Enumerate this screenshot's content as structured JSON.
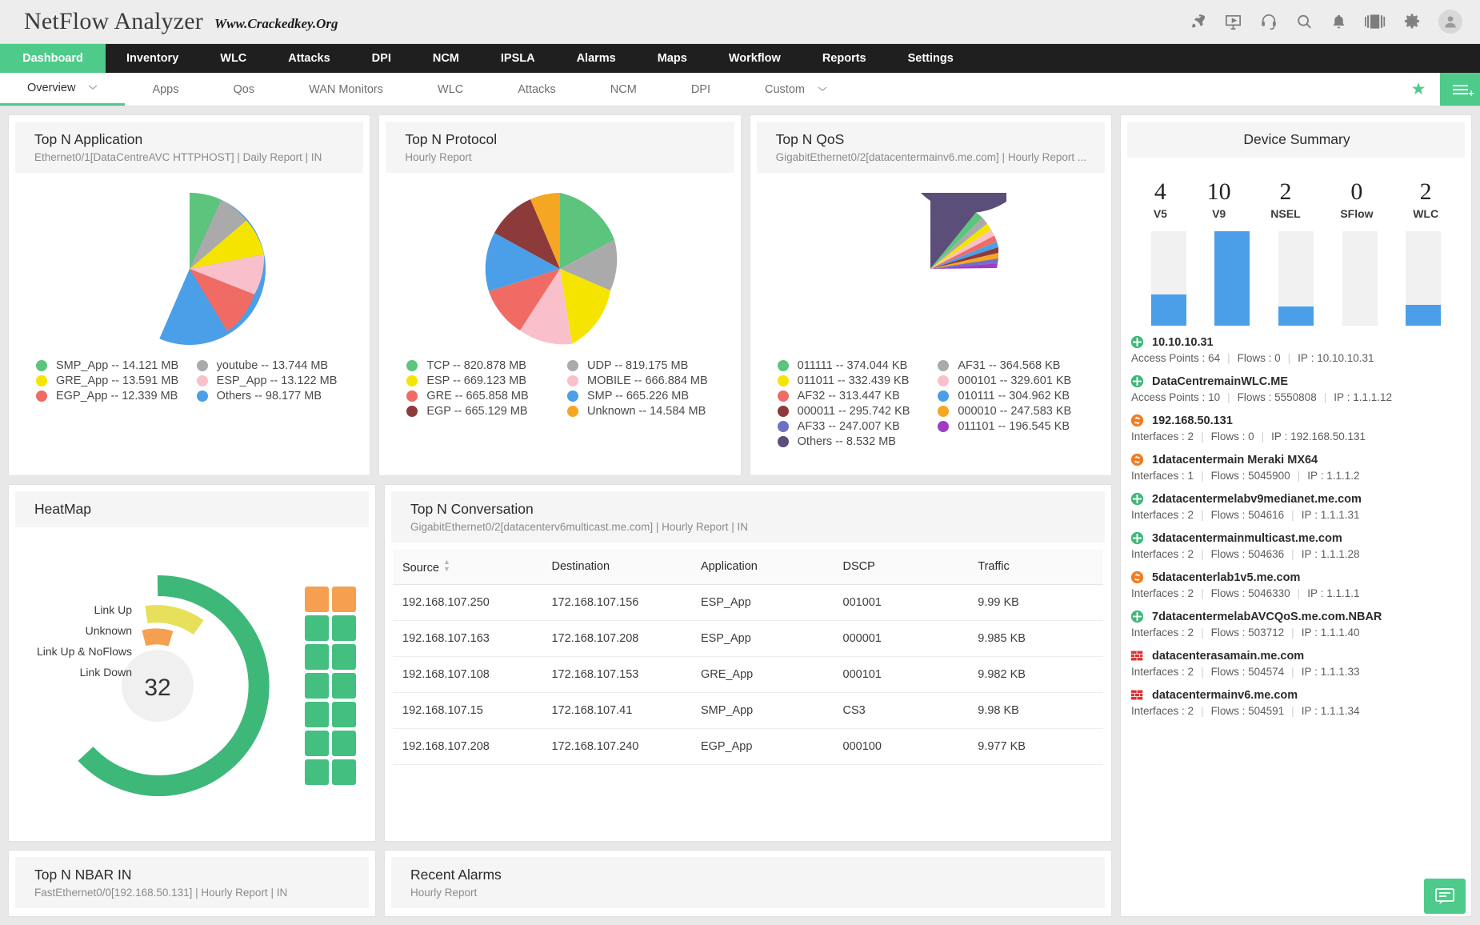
{
  "header": {
    "brand": "NetFlow Analyzer",
    "watermark": "Www.Crackedkey.Org",
    "icons": [
      {
        "name": "rocket-icon",
        "label": "rocket"
      },
      {
        "name": "presentation-icon",
        "label": "presentation"
      },
      {
        "name": "headset-icon",
        "label": "support"
      },
      {
        "name": "search-icon",
        "label": "search"
      },
      {
        "name": "bell-icon",
        "label": "notifications"
      },
      {
        "name": "layout-icon",
        "label": "layout"
      },
      {
        "name": "gear-icon",
        "label": "settings"
      },
      {
        "name": "avatar-icon",
        "label": "user"
      }
    ]
  },
  "mainnav": [
    {
      "label": "Dashboard",
      "active": true
    },
    {
      "label": "Inventory",
      "active": false
    },
    {
      "label": "WLC",
      "active": false
    },
    {
      "label": "Attacks",
      "active": false
    },
    {
      "label": "DPI",
      "active": false
    },
    {
      "label": "NCM",
      "active": false
    },
    {
      "label": "IPSLA",
      "active": false
    },
    {
      "label": "Alarms",
      "active": false
    },
    {
      "label": "Maps",
      "active": false
    },
    {
      "label": "Workflow",
      "active": false
    },
    {
      "label": "Reports",
      "active": false
    },
    {
      "label": "Settings",
      "active": false
    }
  ],
  "subnav": [
    {
      "label": "Overview",
      "active": true,
      "caret": "⌄"
    },
    {
      "label": "Apps",
      "active": false,
      "caret": ""
    },
    {
      "label": "Qos",
      "active": false,
      "caret": ""
    },
    {
      "label": "WAN Monitors",
      "active": false,
      "caret": ""
    },
    {
      "label": "WLC",
      "active": false,
      "caret": ""
    },
    {
      "label": "Attacks",
      "active": false,
      "caret": ""
    },
    {
      "label": "NCM",
      "active": false,
      "caret": ""
    },
    {
      "label": "DPI",
      "active": false,
      "caret": ""
    },
    {
      "label": "Custom",
      "active": false,
      "caret": "⌄"
    }
  ],
  "subnav_actions": {
    "star": "★",
    "burger_plus": "+"
  },
  "chart_data": [
    {
      "type": "pie",
      "title": "Top N Application",
      "subtitle": "Ethernet0/1[DataCentreAVC HTTPHOST] | Daily Report | IN",
      "unit": "MB",
      "legend_position": "bottom",
      "labels": [
        "SMP_App",
        "GRE_App",
        "EGP_App",
        "youtube",
        "ESP_App",
        "Others"
      ],
      "values": [
        14.121,
        13.591,
        12.339,
        13.744,
        13.122,
        98.177
      ],
      "colors": [
        "#5cc47c",
        "#f5e400",
        "#f06b64",
        "#aaaaaa",
        "#f9c0cb",
        "#4a9fe8"
      ],
      "legend": [
        {
          "label": "SMP_App -- 14.121 MB",
          "color": "#5cc47c"
        },
        {
          "label": "GRE_App -- 13.591 MB",
          "color": "#f5e400"
        },
        {
          "label": "EGP_App -- 12.339 MB",
          "color": "#f06b64"
        },
        {
          "label": "youtube -- 13.744 MB",
          "color": "#aaaaaa"
        },
        {
          "label": "ESP_App -- 13.122 MB",
          "color": "#f9c0cb"
        },
        {
          "label": "Others -- 98.177 MB",
          "color": "#4a9fe8"
        }
      ]
    },
    {
      "type": "pie",
      "title": "Top N Protocol",
      "subtitle": "Hourly Report",
      "unit": "MB",
      "legend_position": "bottom",
      "labels": [
        "TCP",
        "ESP",
        "GRE",
        "EGP",
        "UDP",
        "MOBILE",
        "SMP",
        "Unknown"
      ],
      "values": [
        820.878,
        669.123,
        665.858,
        665.129,
        819.175,
        666.884,
        665.226,
        14.584
      ],
      "colors": [
        "#5cc47c",
        "#f5e400",
        "#f06b64",
        "#8c3a3a",
        "#aaaaaa",
        "#f9c0cb",
        "#4a9fe8",
        "#f5a623"
      ],
      "legend": [
        {
          "label": "TCP -- 820.878 MB",
          "color": "#5cc47c"
        },
        {
          "label": "ESP -- 669.123 MB",
          "color": "#f5e400"
        },
        {
          "label": "GRE -- 665.858 MB",
          "color": "#f06b64"
        },
        {
          "label": "EGP -- 665.129 MB",
          "color": "#8c3a3a"
        },
        {
          "label": "UDP -- 819.175 MB",
          "color": "#aaaaaa"
        },
        {
          "label": "MOBILE -- 666.884 MB",
          "color": "#f9c0cb"
        },
        {
          "label": "SMP -- 665.226 MB",
          "color": "#4a9fe8"
        },
        {
          "label": "Unknown -- 14.584 MB",
          "color": "#f5a623"
        }
      ]
    },
    {
      "type": "pie",
      "title": "Top N QoS",
      "subtitle": "GigabitEthernet0/2[datacentermainv6.me.com] | Hourly Report ...",
      "unit": "KB",
      "legend_position": "bottom",
      "labels": [
        "011111",
        "011011",
        "AF32",
        "000011",
        "AF33",
        "Others",
        "AF31",
        "000101",
        "010111",
        "000010",
        "011101"
      ],
      "values": [
        374.044,
        332.439,
        313.447,
        295.742,
        247.007,
        8532,
        364.568,
        329.601,
        304.962,
        247.583,
        196.545
      ],
      "colors": [
        "#5cc47c",
        "#f5e400",
        "#f06b64",
        "#8c3a3a",
        "#6f6fc4",
        "#5b4e78",
        "#aaaaaa",
        "#f9c0cb",
        "#4a9fe8",
        "#f5a623",
        "#a03cc4"
      ],
      "legend": [
        {
          "label": "011111 -- 374.044 KB",
          "color": "#5cc47c"
        },
        {
          "label": "011011 -- 332.439 KB",
          "color": "#f5e400"
        },
        {
          "label": "AF32 -- 313.447 KB",
          "color": "#f06b64"
        },
        {
          "label": "000011 -- 295.742 KB",
          "color": "#8c3a3a"
        },
        {
          "label": "AF33 -- 247.007 KB",
          "color": "#6f6fc4"
        },
        {
          "label": "Others -- 8.532 MB",
          "color": "#5b4e78"
        },
        {
          "label": "AF31 -- 364.568 KB",
          "color": "#aaaaaa"
        },
        {
          "label": "000101 -- 329.601 KB",
          "color": "#f9c0cb"
        },
        {
          "label": "010111 -- 304.962 KB",
          "color": "#4a9fe8"
        },
        {
          "label": "000010 -- 247.583 KB",
          "color": "#f5a623"
        },
        {
          "label": "011101 -- 196.545 KB",
          "color": "#a03cc4"
        }
      ]
    },
    {
      "type": "pie",
      "title": "HeatMap",
      "subtitle": "",
      "center_value": "32",
      "labels": [
        "Link Up",
        "Unknown",
        "Link Up & NoFlows",
        "Link Down"
      ],
      "values": [
        28,
        3,
        1,
        0
      ],
      "colors": [
        "#3eb878",
        "#e6e05a",
        "#f5a050",
        "#cccccc"
      ],
      "legend": [
        {
          "label": "Link Up",
          "color": "#3eb878"
        },
        {
          "label": "Unknown",
          "color": "#e6e05a"
        },
        {
          "label": "Link Up & NoFlows",
          "color": "#f5a050"
        },
        {
          "label": "Link Down",
          "color": "#cccccc"
        }
      ],
      "grid_cells": [
        "#f5a050",
        "#f5a050",
        "#43bf80",
        "#43bf80",
        "#43bf80",
        "#43bf80",
        "#43bf80",
        "#43bf80",
        "#43bf80",
        "#43bf80",
        "#43bf80",
        "#43bf80",
        "#43bf80",
        "#43bf80"
      ]
    },
    {
      "type": "bar",
      "title": "Device Summary",
      "categories": [
        "V5",
        "V9",
        "NSEL",
        "SFlow",
        "WLC"
      ],
      "values": [
        4,
        10,
        2,
        0,
        2
      ],
      "fill_pct": [
        33,
        100,
        20,
        0,
        22
      ],
      "color": "#4a9fe8",
      "track_color": "#f1f1f1"
    }
  ],
  "cards": {
    "top_application": {
      "title": "Top N Application",
      "subtitle": "Ethernet0/1[DataCentreAVC HTTPHOST] | Daily Report | IN"
    },
    "top_protocol": {
      "title": "Top N Protocol",
      "subtitle": "Hourly Report"
    },
    "top_qos": {
      "title": "Top N QoS",
      "subtitle": "GigabitEthernet0/2[datacentermainv6.me.com] | Hourly Report ..."
    },
    "device_summary": {
      "title": "Device Summary"
    },
    "heatmap": {
      "title": "HeatMap"
    },
    "top_conversation": {
      "title": "Top N Conversation",
      "subtitle": "GigabitEthernet0/2[datacenterv6multicast.me.com] | Hourly Report | IN"
    },
    "recent_alarms": {
      "title": "Recent Alarms",
      "subtitle": "Hourly Report"
    },
    "top_nbar": {
      "title": "Top N NBAR IN",
      "subtitle": "FastEthernet0/0[192.168.50.131] | Hourly Report | IN"
    }
  },
  "conversation_table": {
    "columns": [
      "Source",
      "Destination",
      "Application",
      "DSCP",
      "Traffic"
    ],
    "sorted_column": "Source",
    "rows": [
      {
        "source": "192.168.107.250",
        "destination": "172.168.107.156",
        "application": "ESP_App",
        "dscp": "001001",
        "traffic": "9.99 KB"
      },
      {
        "source": "192.168.107.163",
        "destination": "172.168.107.208",
        "application": "ESP_App",
        "dscp": "000001",
        "traffic": "9.985 KB"
      },
      {
        "source": "192.168.107.108",
        "destination": "172.168.107.153",
        "application": "GRE_App",
        "dscp": "000101",
        "traffic": "9.982 KB"
      },
      {
        "source": "192.168.107.15",
        "destination": "172.168.107.41",
        "application": "SMP_App",
        "dscp": "CS3",
        "traffic": "9.98 KB"
      },
      {
        "source": "192.168.107.208",
        "destination": "172.168.107.240",
        "application": "EGP_App",
        "dscp": "000100",
        "traffic": "9.977 KB"
      }
    ]
  },
  "device_list": [
    {
      "icon": "router-icon",
      "icon_color": "#3eb878",
      "name": "10.10.10.31",
      "metric_label": "Access Points",
      "metric_value": "64",
      "flows_label": "Flows",
      "flows_value": "0",
      "ip_label": "IP",
      "ip_value": "10.10.10.31"
    },
    {
      "icon": "router-icon",
      "icon_color": "#3eb878",
      "name": "DataCentremainWLC.ME",
      "metric_label": "Access Points",
      "metric_value": "10",
      "flows_label": "Flows",
      "flows_value": "5550808",
      "ip_label": "IP",
      "ip_value": "1.1.1.12"
    },
    {
      "icon": "switch-icon",
      "icon_color": "#f07d22",
      "name": "192.168.50.131",
      "metric_label": "Interfaces",
      "metric_value": "2",
      "flows_label": "Flows",
      "flows_value": "0",
      "ip_label": "IP",
      "ip_value": "192.168.50.131"
    },
    {
      "icon": "switch-icon",
      "icon_color": "#f07d22",
      "name": "1datacentermain Meraki MX64",
      "metric_label": "Interfaces",
      "metric_value": "1",
      "flows_label": "Flows",
      "flows_value": "5045900",
      "ip_label": "IP",
      "ip_value": "1.1.1.2"
    },
    {
      "icon": "router-icon",
      "icon_color": "#3eb878",
      "name": "2datacentermelabv9medianet.me.com",
      "metric_label": "Interfaces",
      "metric_value": "2",
      "flows_label": "Flows",
      "flows_value": "504616",
      "ip_label": "IP",
      "ip_value": "1.1.1.31"
    },
    {
      "icon": "router-icon",
      "icon_color": "#3eb878",
      "name": "3datacentermainmulticast.me.com",
      "metric_label": "Interfaces",
      "metric_value": "2",
      "flows_label": "Flows",
      "flows_value": "504636",
      "ip_label": "IP",
      "ip_value": "1.1.1.28"
    },
    {
      "icon": "switch-icon",
      "icon_color": "#f07d22",
      "name": "5datacenterlab1v5.me.com",
      "metric_label": "Interfaces",
      "metric_value": "2",
      "flows_label": "Flows",
      "flows_value": "5046330",
      "ip_label": "IP",
      "ip_value": "1.1.1.1"
    },
    {
      "icon": "router-icon",
      "icon_color": "#3eb878",
      "name": "7datacentermelabAVCQoS.me.com.NBAR",
      "metric_label": "Interfaces",
      "metric_value": "2",
      "flows_label": "Flows",
      "flows_value": "503712",
      "ip_label": "IP",
      "ip_value": "1.1.1.40"
    },
    {
      "icon": "firewall-icon",
      "icon_color": "#e03131",
      "name": "datacenterasamain.me.com",
      "metric_label": "Interfaces",
      "metric_value": "2",
      "flows_label": "Flows",
      "flows_value": "504574",
      "ip_label": "IP",
      "ip_value": "1.1.1.33"
    },
    {
      "icon": "firewall-icon",
      "icon_color": "#e03131",
      "name": "datacentermainv6.me.com",
      "metric_label": "Interfaces",
      "metric_value": "2",
      "flows_label": "Flows",
      "flows_value": "504591",
      "ip_label": "IP",
      "ip_value": "1.1.1.34"
    }
  ],
  "fab": {
    "name": "chat-icon"
  },
  "colors": {
    "accent_green": "#4ecb8b",
    "nav_dark": "#1f1f1f",
    "blue": "#4a9fe8"
  }
}
